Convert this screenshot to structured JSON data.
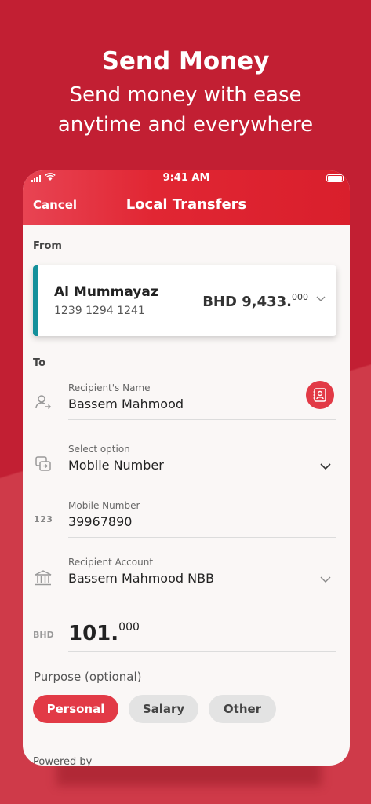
{
  "hero": {
    "title": "Send Money",
    "subtitle_line1": "Send money with ease",
    "subtitle_line2": "anytime and everywhere"
  },
  "status_bar": {
    "time": "9:41 AM"
  },
  "header": {
    "cancel_label": "Cancel",
    "title": "Local Transfers"
  },
  "from": {
    "label": "From",
    "account_name": "Al Mummayaz",
    "account_number": "1239 1294 1241",
    "balance_currency": "BHD",
    "balance_whole": "9,433.",
    "balance_decimal": "000"
  },
  "to": {
    "label": "To",
    "recipient_name": {
      "label": "Recipient's Name",
      "value": "Bassem Mahmood"
    },
    "select_option": {
      "label": "Select option",
      "value": "Mobile Number"
    },
    "mobile_number": {
      "prefix": "123",
      "label": "Mobile Number",
      "value": "39967890"
    },
    "recipient_account": {
      "label": "Recipient Account",
      "value": "Bassem Mahmood NBB"
    }
  },
  "amount": {
    "currency": "BHD",
    "whole": "101.",
    "decimal": "000"
  },
  "purpose": {
    "label": "Purpose (optional)",
    "options": [
      "Personal",
      "Salary",
      "Other"
    ],
    "selected": "Personal"
  },
  "footer": {
    "powered_by": "Powered by"
  },
  "colors": {
    "brand_red": "#c21f33",
    "accent_red": "#e23a46",
    "card_accent_teal": "#14909b"
  },
  "icons": {
    "recipient": "user-arrow-icon",
    "contacts": "contacts-book-icon",
    "select_option": "transfer-method-icon",
    "account": "bank-icon",
    "chevron": "chevron-down-icon"
  }
}
